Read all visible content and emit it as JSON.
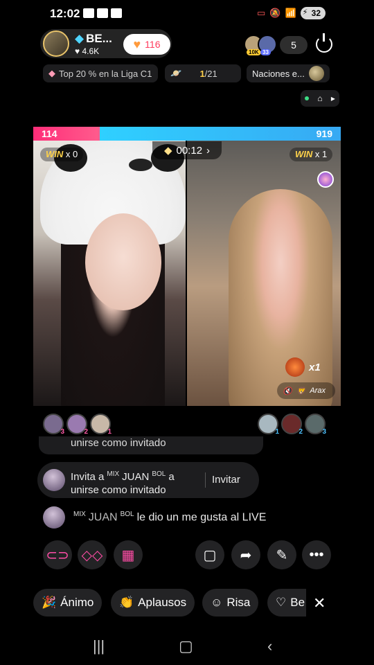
{
  "status_bar": {
    "time": "12:02",
    "battery": "32"
  },
  "host": {
    "name": "BE...",
    "likes": "4.6K",
    "follow_count": "116"
  },
  "viewers": {
    "badges": [
      "10K",
      "33"
    ],
    "count": "5"
  },
  "info_pills": {
    "league": "Top 20 % en la Liga C1",
    "rank": "1/21",
    "rank_highlight": "1",
    "nations": "Naciones e..."
  },
  "battle": {
    "score_left": "114",
    "score_right": "919",
    "timer": "00:12",
    "win_left_label": "WIN",
    "win_left_count": "x 0",
    "win_right_label": "WIN",
    "win_right_count": "x 1",
    "gift_multiplier": "x1",
    "mute_label": "Arax"
  },
  "supporters": {
    "left": [
      "3",
      "2",
      "1"
    ],
    "right": [
      "1",
      "2",
      "3"
    ]
  },
  "chat": {
    "partial_text": "unirse como invitado",
    "invite": {
      "prefix": "Invita a",
      "tag1": "MIX",
      "user": "JUAN",
      "tag2": "BOL",
      "suffix": "a",
      "line2": "unirse como invitado",
      "button": "Invitar"
    },
    "like": {
      "tag1": "MIX",
      "user": "JUAN",
      "tag2": "BOL",
      "text": "le dio un me gusta al LIVE"
    }
  },
  "reactions": [
    "Ánimo",
    "Aplausos",
    "Risa",
    "Be"
  ],
  "colors": {
    "accent_pink": "#ff2d78",
    "accent_blue": "#2fd0ff",
    "win_gold": "#ffd24a"
  }
}
